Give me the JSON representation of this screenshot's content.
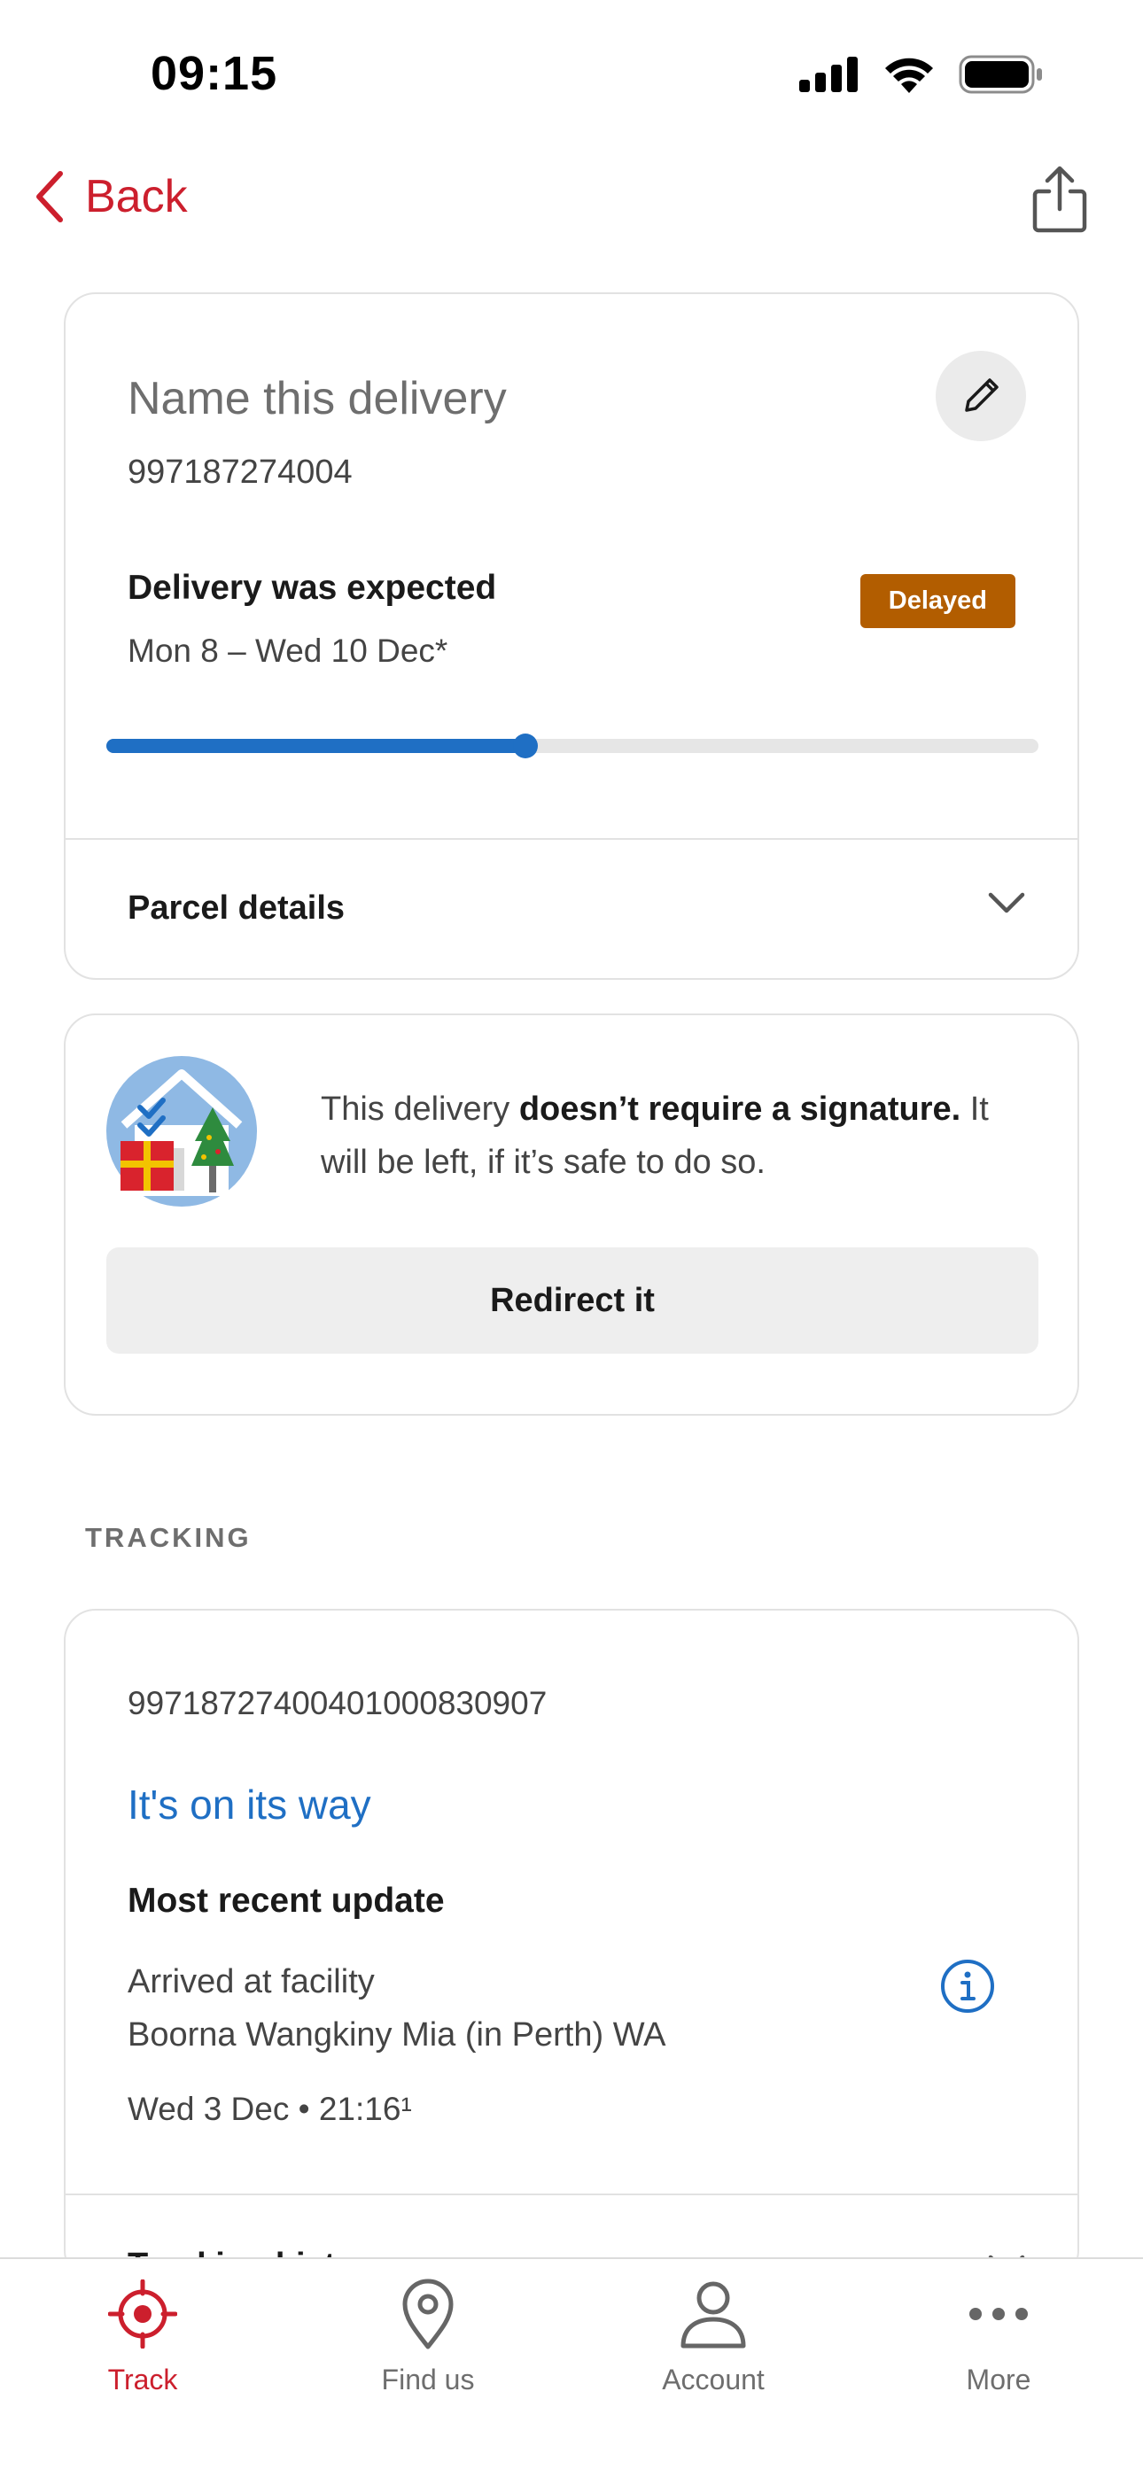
{
  "status_bar": {
    "time": "09:15"
  },
  "nav": {
    "back_label": "Back"
  },
  "delivery": {
    "name_placeholder": "Name this delivery",
    "tracking_number": "997187274004",
    "expected_label": "Delivery was expected",
    "expected_dates": "Mon 8 – Wed 10 Dec*",
    "status_badge": "Delayed",
    "badge_color": "#b25d00",
    "progress_fraction": 0.45,
    "parcel_details_label": "Parcel details"
  },
  "signature": {
    "text_prefix": "This delivery ",
    "text_bold": "doesn’t require a signature.",
    "text_suffix": " It will be left, if it’s safe to do so.",
    "redirect_label": "Redirect it"
  },
  "tracking": {
    "section_heading": "TRACKING",
    "item_number": "99718727400401000830907",
    "status": "It's on its way",
    "recent_update_label": "Most recent update",
    "event_title": "Arrived at facility",
    "event_location": "Boorna Wangkiny Mia (in Perth) WA",
    "event_datetime": "Wed 3 Dec • 21:16¹",
    "history_label": "Tracking history"
  },
  "tabs": [
    {
      "label": "Track",
      "icon": "track-target-icon",
      "active": true
    },
    {
      "label": "Find us",
      "icon": "location-pin-icon",
      "active": false
    },
    {
      "label": "Account",
      "icon": "person-icon",
      "active": false
    },
    {
      "label": "More",
      "icon": "more-dots-icon",
      "active": false
    }
  ],
  "colors": {
    "brand_red": "#cc1f2d",
    "link_blue": "#1f6fc4"
  }
}
